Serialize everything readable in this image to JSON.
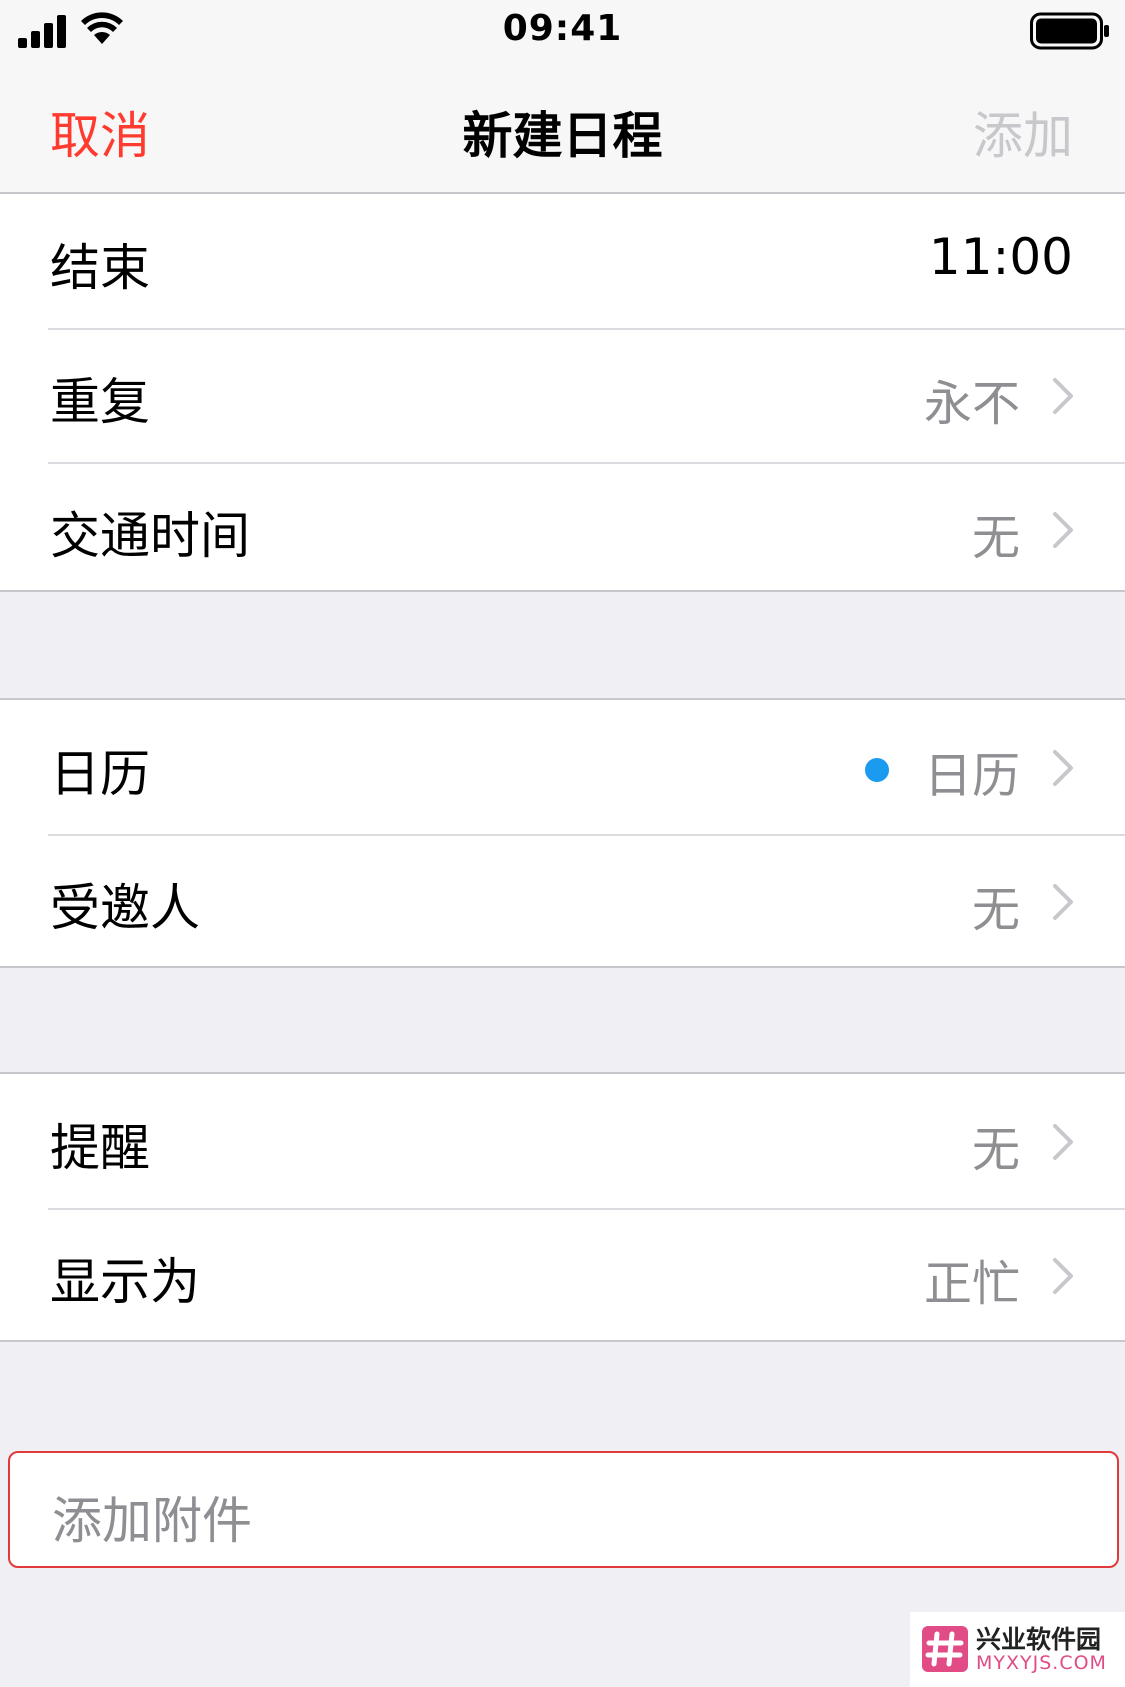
{
  "status_bar": {
    "time": "09:41"
  },
  "nav": {
    "cancel_label": "取消",
    "title": "新建日程",
    "add_label": "添加"
  },
  "groups": [
    {
      "rows": [
        {
          "label": "结束",
          "value": "11:00"
        },
        {
          "label": "重复",
          "value": "永不"
        },
        {
          "label": "交通时间",
          "value": "无"
        }
      ]
    },
    {
      "rows": [
        {
          "label": "日历",
          "value": "日历",
          "dot_color": "#1a9bef"
        },
        {
          "label": "受邀人",
          "value": "无"
        }
      ]
    },
    {
      "rows": [
        {
          "label": "提醒",
          "value": "无"
        },
        {
          "label": "显示为",
          "value": "正忙"
        }
      ]
    }
  ],
  "attachment": {
    "label": "添加附件",
    "highlight_color": "#e03a3a"
  },
  "watermark": {
    "name": "兴业软件园",
    "site": "MYXYJS.COM"
  },
  "colors": {
    "accent": "#ff3b30",
    "disabled": "#c7c7cc",
    "secondary_text": "#8e8e93",
    "background": "#efeff4"
  }
}
